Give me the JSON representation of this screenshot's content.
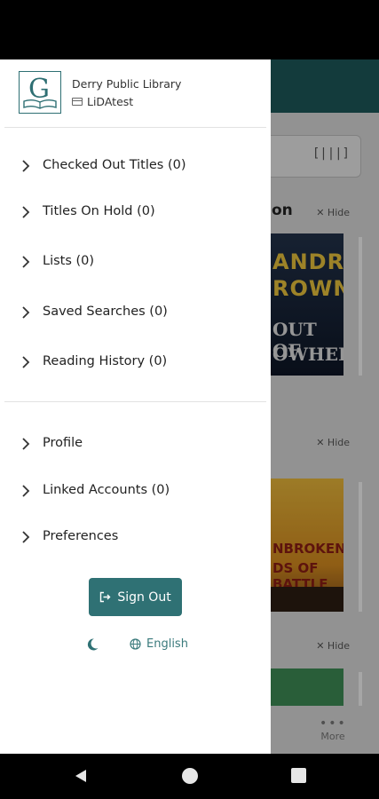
{
  "drawer": {
    "library_name": "Derry Public Library",
    "account_name": "LiDAtest",
    "logo_letter": "G",
    "menu_primary": [
      {
        "label": "Checked Out Titles (0)"
      },
      {
        "label": "Titles On Hold (0)"
      },
      {
        "label": "Lists (0)"
      },
      {
        "label": "Saved Searches (0)"
      },
      {
        "label": "Reading History (0)"
      }
    ],
    "menu_secondary": [
      {
        "label": "Profile"
      },
      {
        "label": "Linked Accounts (0)"
      },
      {
        "label": "Preferences"
      }
    ],
    "sign_out_label": "Sign Out",
    "language_label": "English"
  },
  "background": {
    "section_title_fragment": "on",
    "hide_label": "Hide",
    "more_label": "More",
    "scan_glyph": "[|||]",
    "covers": [
      {
        "line1": "ANDRA",
        "line2": "ROWN",
        "line3": "OUT OF",
        "line4": "OWHERE"
      },
      {
        "line1": "NBROKEN",
        "line2": "DS OF BATTLE"
      }
    ]
  },
  "colors": {
    "accent": "#2f7174",
    "header": "#1c5759"
  }
}
